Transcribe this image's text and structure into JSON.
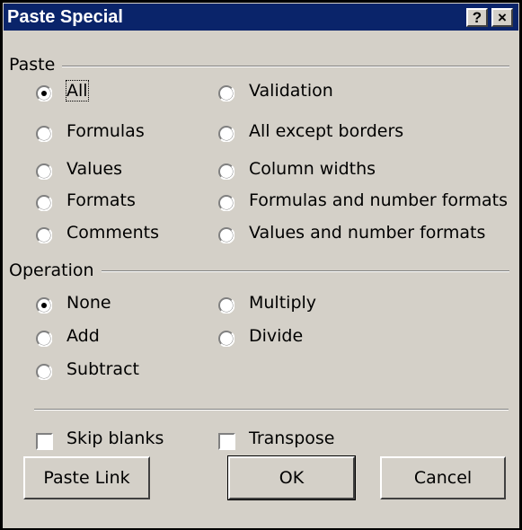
{
  "title": "Paste Special",
  "title_buttons": {
    "help": "?",
    "close": "×"
  },
  "paste": {
    "label": "Paste",
    "options": [
      {
        "label": "All",
        "checked": true
      },
      {
        "label": "Formulas",
        "checked": false
      },
      {
        "label": "Values",
        "checked": false
      },
      {
        "label": "Formats",
        "checked": false
      },
      {
        "label": "Comments",
        "checked": false
      },
      {
        "label": "Validation",
        "checked": false
      },
      {
        "label": "All except borders",
        "checked": false
      },
      {
        "label": "Column widths",
        "checked": false
      },
      {
        "label": "Formulas and number formats",
        "checked": false
      },
      {
        "label": "Values and number formats",
        "checked": false
      }
    ]
  },
  "operation": {
    "label": "Operation",
    "options": [
      {
        "label": "None",
        "checked": true
      },
      {
        "label": "Add",
        "checked": false
      },
      {
        "label": "Subtract",
        "checked": false
      },
      {
        "label": "Multiply",
        "checked": false
      },
      {
        "label": "Divide",
        "checked": false
      }
    ]
  },
  "checkboxes": [
    {
      "label": "Skip blanks",
      "checked": false
    },
    {
      "label": "Transpose",
      "checked": false
    }
  ],
  "buttons": {
    "paste_link": "Paste Link",
    "ok": "OK",
    "cancel": "Cancel"
  },
  "colors": {
    "titlebar": "#0a246a",
    "face": "#d4d0c8"
  }
}
